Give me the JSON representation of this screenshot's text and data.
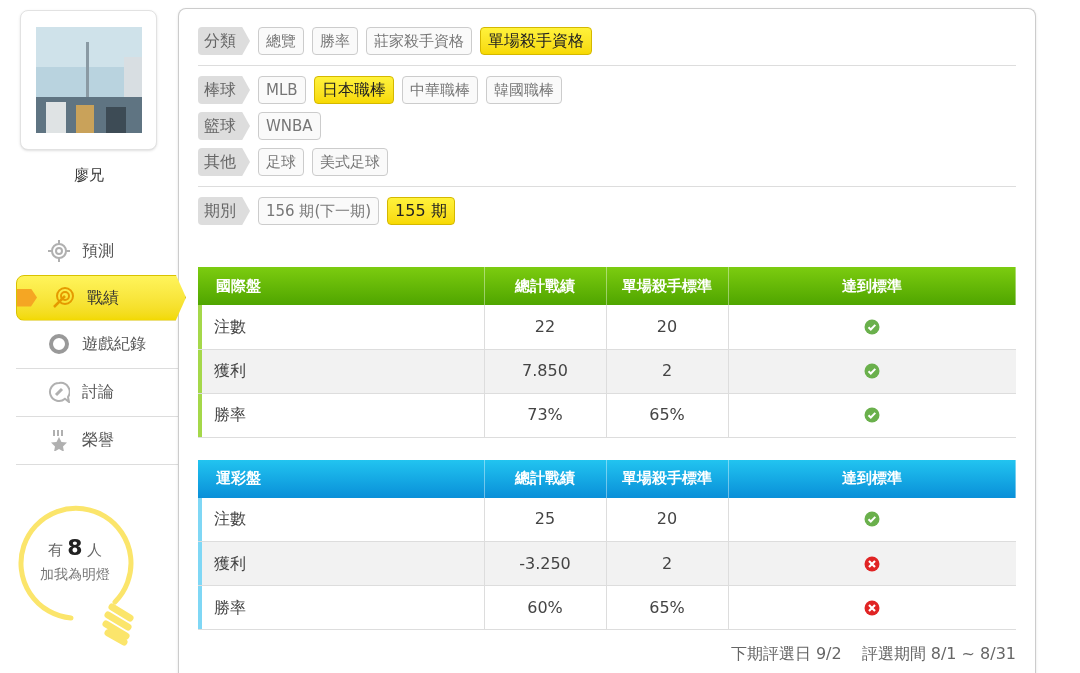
{
  "profile": {
    "name": "廖兄"
  },
  "nav": [
    {
      "label": "預測",
      "selected": false
    },
    {
      "label": "戰績",
      "selected": true
    },
    {
      "label": "遊戲紀錄",
      "selected": false
    },
    {
      "label": "討論",
      "selected": false
    },
    {
      "label": "榮譽",
      "selected": false
    }
  ],
  "fans": {
    "prefix": "有",
    "count": "8",
    "suffix": "人",
    "caption": "加我為明燈"
  },
  "filter_groups": [
    [
      {
        "label": "分類",
        "options": [
          {
            "label": "總覽",
            "selected": false
          },
          {
            "label": "勝率",
            "selected": false
          },
          {
            "label": "莊家殺手資格",
            "selected": false
          },
          {
            "label": "單場殺手資格",
            "selected": true
          }
        ]
      }
    ],
    [
      {
        "label": "棒球",
        "options": [
          {
            "label": "MLB",
            "selected": false
          },
          {
            "label": "日本職棒",
            "selected": true
          },
          {
            "label": "中華職棒",
            "selected": false
          },
          {
            "label": "韓國職棒",
            "selected": false
          }
        ]
      },
      {
        "label": "籃球",
        "options": [
          {
            "label": "WNBA",
            "selected": false
          }
        ]
      },
      {
        "label": "其他",
        "options": [
          {
            "label": "足球",
            "selected": false
          },
          {
            "label": "美式足球",
            "selected": false
          }
        ]
      }
    ],
    [
      {
        "label": "期別",
        "options": [
          {
            "label": "156 期(下一期)",
            "selected": false
          },
          {
            "label": "155 期",
            "selected": true
          }
        ]
      }
    ]
  ],
  "tables": [
    {
      "kind": "green",
      "columns": [
        "國際盤",
        "總計戰績",
        "單場殺手標準",
        "達到標準"
      ],
      "rows": [
        {
          "item": "注數",
          "total": "22",
          "standard": "20",
          "met": true
        },
        {
          "item": "獲利",
          "total": "7.850",
          "standard": "2",
          "met": true
        },
        {
          "item": "勝率",
          "total": "73%",
          "standard": "65%",
          "met": true
        }
      ]
    },
    {
      "kind": "blue",
      "columns": [
        "運彩盤",
        "總計戰績",
        "單場殺手標準",
        "達到標準"
      ],
      "rows": [
        {
          "item": "注數",
          "total": "25",
          "standard": "20",
          "met": true
        },
        {
          "item": "獲利",
          "total": "-3.250",
          "standard": "2",
          "met": false
        },
        {
          "item": "勝率",
          "total": "60%",
          "standard": "65%",
          "met": false
        }
      ]
    }
  ],
  "footer": {
    "next_date": "下期評選日 9/2",
    "period": "評選期間 8/1 ~ 8/31"
  }
}
